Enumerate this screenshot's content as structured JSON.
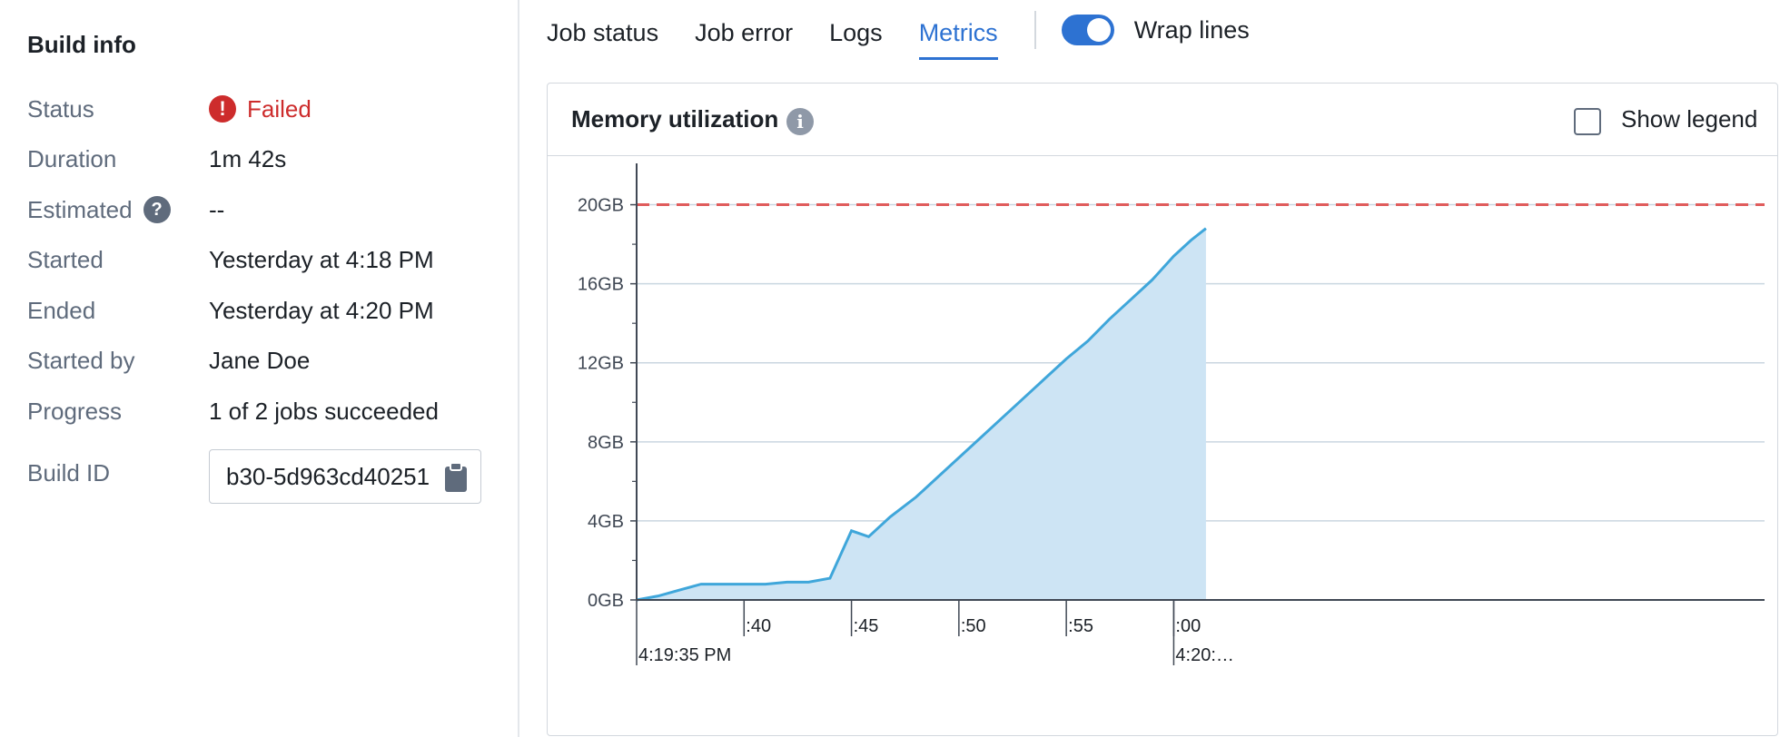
{
  "build_info": {
    "title": "Build info",
    "rows": [
      {
        "key": "Status",
        "value": "Failed"
      },
      {
        "key": "Duration",
        "value": "1m 42s"
      },
      {
        "key": "Estimated",
        "value": "--"
      },
      {
        "key": "Started",
        "value": "Yesterday at 4:18 PM"
      },
      {
        "key": "Ended",
        "value": "Yesterday at 4:20 PM"
      },
      {
        "key": "Started by",
        "value": "Jane Doe"
      },
      {
        "key": "Progress",
        "value": "1 of 2 jobs succeeded"
      },
      {
        "key": "Build ID",
        "value": "b30-5d963cd40251"
      }
    ],
    "status_color": "#cd2c2c",
    "icons": {
      "status": "error-icon",
      "estimated": "help-icon",
      "copy": "clipboard-icon"
    }
  },
  "tabs": {
    "items": [
      {
        "label": "Job status"
      },
      {
        "label": "Job error"
      },
      {
        "label": "Logs"
      },
      {
        "label": "Metrics"
      }
    ],
    "active": "Metrics",
    "wrap_label": "Wrap lines",
    "wrap_on": true,
    "accent": "#2d72d2"
  },
  "card": {
    "title": "Memory utilization",
    "info_icon": "info-icon",
    "legend_label": "Show legend",
    "legend_checked": false
  },
  "chart_data": {
    "type": "area",
    "title": "Memory utilization",
    "y_unit": "GB",
    "ylim": [
      0,
      22
    ],
    "yticks": [
      "0GB",
      "4GB",
      "8GB",
      "12GB",
      "16GB",
      "20GB"
    ],
    "ytick_values": [
      0,
      4,
      8,
      12,
      16,
      20
    ],
    "x_unit": "seconds after 4:19:35 PM",
    "xlim": [
      0,
      52.5
    ],
    "xticks": [
      {
        "label": "4:19:35 PM",
        "at": 0
      },
      {
        "label": ":40",
        "at": 5
      },
      {
        "label": ":45",
        "at": 10
      },
      {
        "label": ":50",
        "at": 15
      },
      {
        "label": ":55",
        "at": 20
      },
      {
        "label": ":00",
        "at": 25
      },
      {
        "label": "4:20:…",
        "at": 25
      }
    ],
    "limit_line": {
      "value": 20,
      "color": "#e05c5c"
    },
    "series": [
      {
        "color": "#3fa6da",
        "fill": "#cde4f4",
        "x": [
          0,
          1,
          2,
          3,
          4,
          5,
          6,
          7,
          8,
          9,
          10,
          10.8,
          11.8,
          13,
          14,
          15,
          16,
          17,
          18,
          19,
          20,
          21,
          22,
          23,
          24,
          25,
          25.8,
          26.5
        ],
        "y": [
          0,
          0.2,
          0.5,
          0.8,
          0.8,
          0.8,
          0.8,
          0.9,
          0.9,
          1.1,
          3.5,
          3.2,
          4.2,
          5.2,
          6.2,
          7.2,
          8.2,
          9.2,
          10.2,
          11.2,
          12.2,
          13.1,
          14.2,
          15.2,
          16.2,
          17.4,
          18.2,
          18.8
        ]
      }
    ],
    "grid": true
  }
}
